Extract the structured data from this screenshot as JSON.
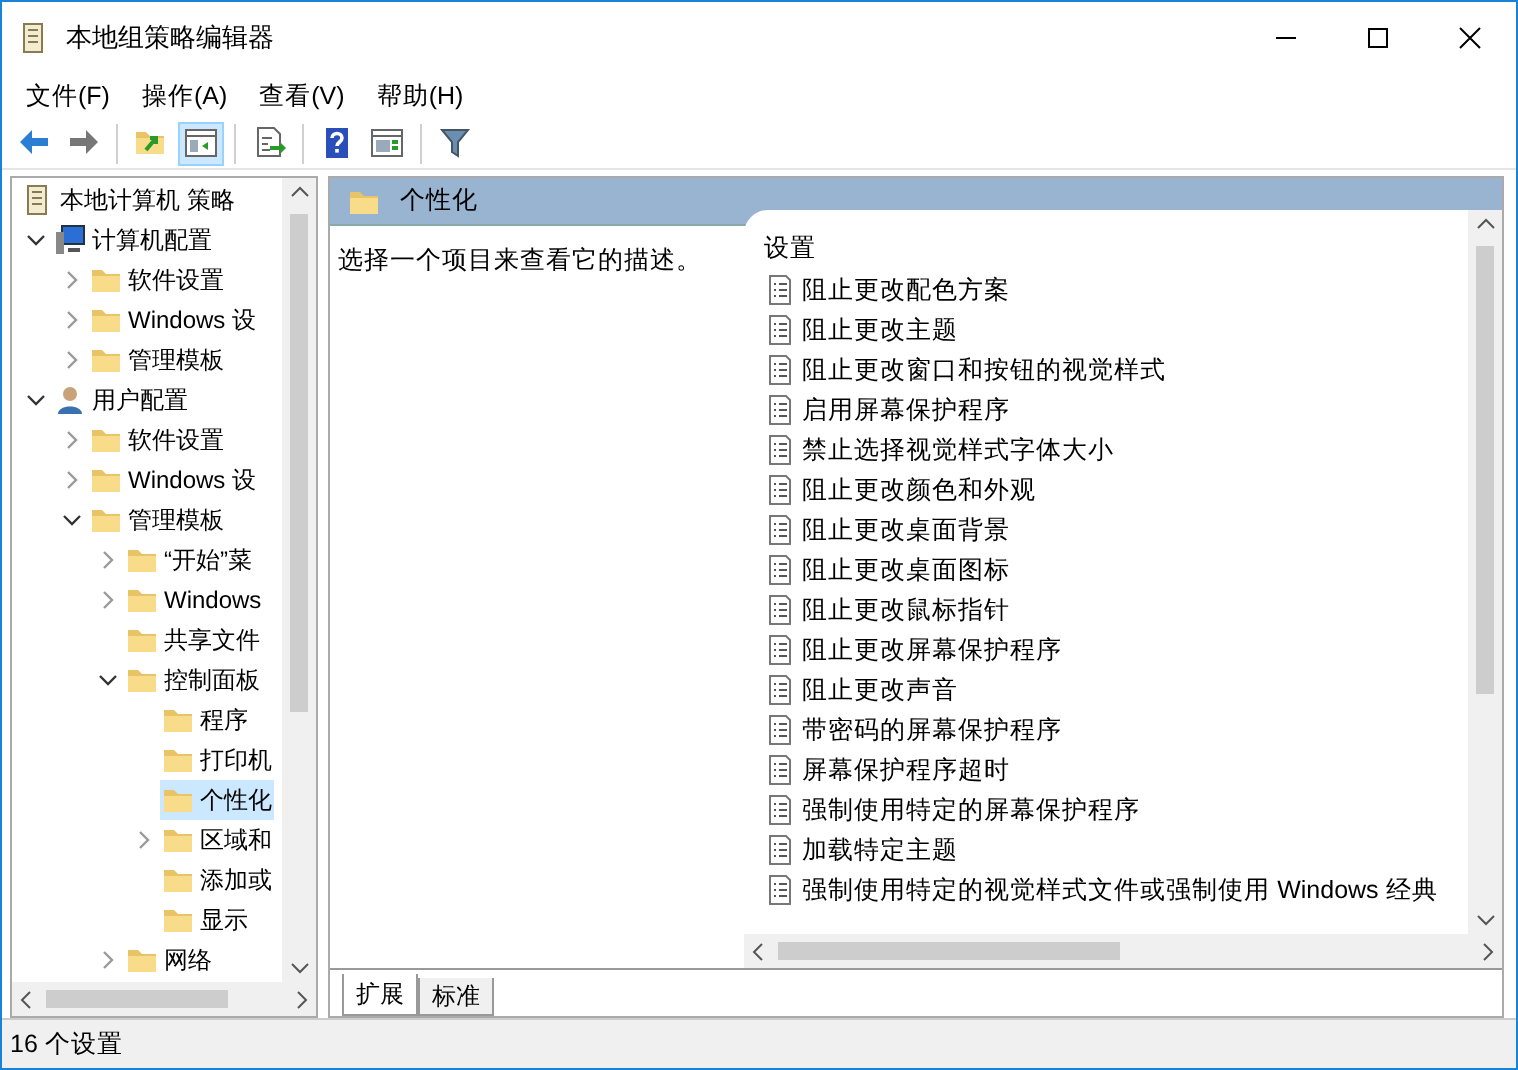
{
  "window": {
    "title": "本地组策略编辑器"
  },
  "menu": [
    "文件(F)",
    "操作(A)",
    "查看(V)",
    "帮助(H)"
  ],
  "toolbar": [
    {
      "kind": "back",
      "selected": false
    },
    {
      "kind": "forward",
      "selected": false
    },
    {
      "kind": "sep"
    },
    {
      "kind": "up",
      "selected": false
    },
    {
      "kind": "tree",
      "selected": true
    },
    {
      "kind": "sep"
    },
    {
      "kind": "export",
      "selected": false
    },
    {
      "kind": "sep"
    },
    {
      "kind": "help",
      "selected": false
    },
    {
      "kind": "props",
      "selected": false
    },
    {
      "kind": "sep"
    },
    {
      "kind": "filter",
      "selected": false
    }
  ],
  "tree": [
    {
      "label": "本地计算机 策略",
      "kind": "policy",
      "selected": false,
      "children": [
        {
          "label": "计算机配置",
          "kind": "computer",
          "selected": false,
          "expanded": true,
          "children": [
            {
              "label": "软件设置",
              "kind": "folder",
              "selected": false,
              "expanded": false
            },
            {
              "label": "Windows 设",
              "kind": "folder",
              "selected": false,
              "expanded": false
            },
            {
              "label": "管理模板",
              "kind": "folder",
              "selected": false,
              "expanded": false
            }
          ]
        },
        {
          "label": "用户配置",
          "kind": "user",
          "selected": false,
          "expanded": true,
          "children": [
            {
              "label": "软件设置",
              "kind": "folder",
              "selected": false,
              "expanded": false
            },
            {
              "label": "Windows 设",
              "kind": "folder",
              "selected": false,
              "expanded": false
            },
            {
              "label": "管理模板",
              "kind": "folder",
              "selected": false,
              "expanded": true,
              "children": [
                {
                  "label": "“开始”菜",
                  "kind": "folder",
                  "selected": false,
                  "expanded": false
                },
                {
                  "label": "Windows",
                  "kind": "folder",
                  "selected": false,
                  "expanded": false
                },
                {
                  "label": "共享文件",
                  "kind": "folder",
                  "selected": false
                },
                {
                  "label": "控制面板",
                  "kind": "folder",
                  "selected": false,
                  "expanded": true,
                  "children": [
                    {
                      "label": "程序",
                      "kind": "folder",
                      "selected": false
                    },
                    {
                      "label": "打印机",
                      "kind": "folder",
                      "selected": false
                    },
                    {
                      "label": "个性化",
                      "kind": "folder",
                      "selected": true
                    },
                    {
                      "label": "区域和",
                      "kind": "folder",
                      "selected": false,
                      "expanded": false
                    },
                    {
                      "label": "添加或",
                      "kind": "folder",
                      "selected": false
                    },
                    {
                      "label": "显示",
                      "kind": "folder",
                      "selected": false
                    }
                  ]
                },
                {
                  "label": "网络",
                  "kind": "folder",
                  "selected": false,
                  "expanded": false
                }
              ]
            }
          ]
        }
      ]
    }
  ],
  "panel": {
    "title": "个性化",
    "description": "选择一个项目来查看它的描述。",
    "column": "设置",
    "settings": [
      "阻止更改配色方案",
      "阻止更改主题",
      "阻止更改窗口和按钮的视觉样式",
      "启用屏幕保护程序",
      "禁止选择视觉样式字体大小",
      "阻止更改颜色和外观",
      "阻止更改桌面背景",
      "阻止更改桌面图标",
      "阻止更改鼠标指针",
      "阻止更改屏幕保护程序",
      "阻止更改声音",
      "带密码的屏幕保护程序",
      "屏幕保护程序超时",
      "强制使用特定的屏幕保护程序",
      "加载特定主题",
      "强制使用特定的视觉样式文件或强制使用 Windows 经典"
    ]
  },
  "tabs": [
    {
      "label": "扩展",
      "selected": true
    },
    {
      "label": "标准",
      "selected": false
    }
  ],
  "status_bar": "16 个设置"
}
